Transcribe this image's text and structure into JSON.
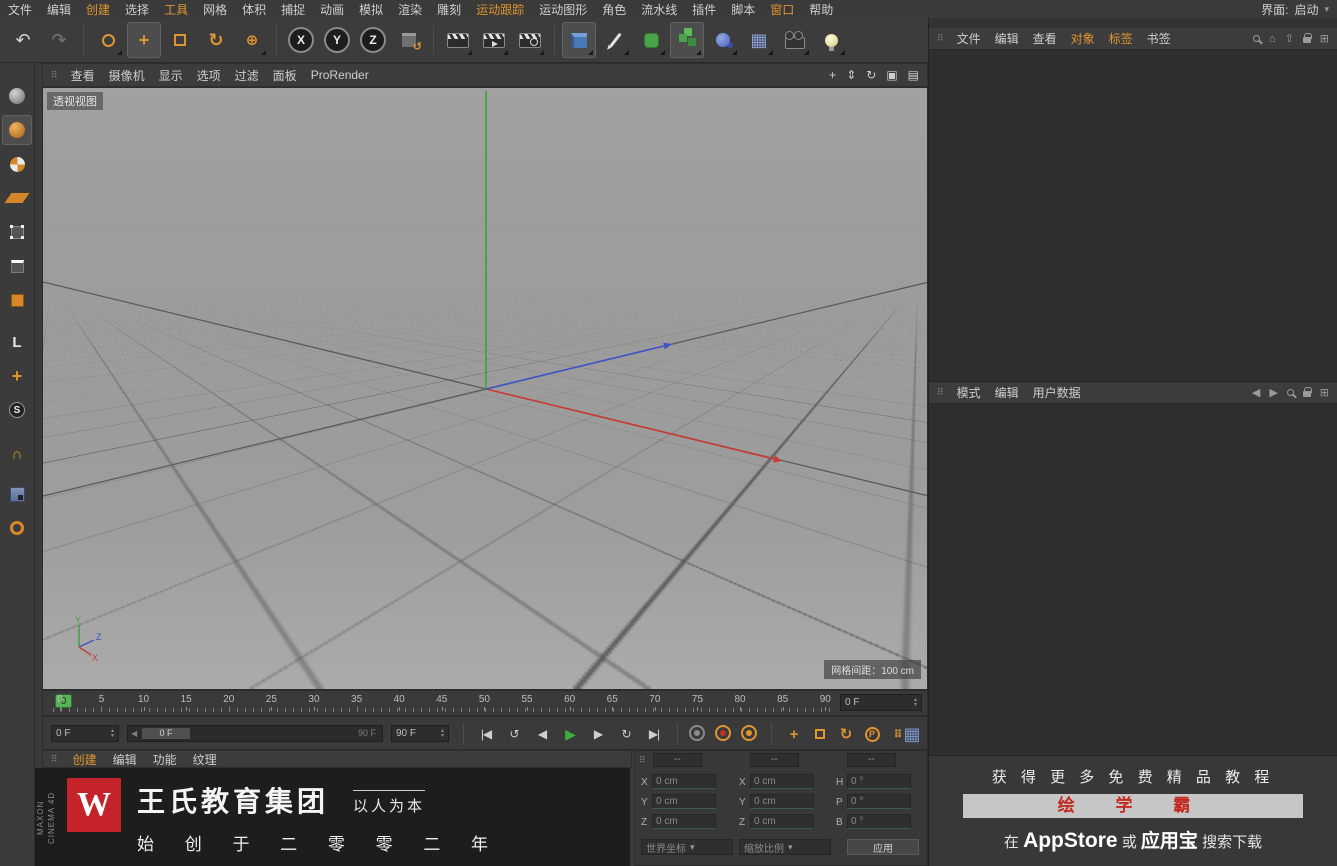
{
  "colors": {
    "accent": "#e0952f",
    "play_green": "#3fae3f",
    "banner_red": "#c4232a",
    "axis_red": "#cc3a33",
    "axis_green": "#3aa33a",
    "axis_blue": "#4053c8",
    "viewport_gray": "#9d9d9d"
  },
  "menubar": {
    "items": [
      {
        "label": "文件",
        "hl": false
      },
      {
        "label": "编辑",
        "hl": false
      },
      {
        "label": "创建",
        "hl": true
      },
      {
        "label": "选择",
        "hl": false
      },
      {
        "label": "工具",
        "hl": true
      },
      {
        "label": "网格",
        "hl": false
      },
      {
        "label": "体积",
        "hl": false
      },
      {
        "label": "捕捉",
        "hl": false
      },
      {
        "label": "动画",
        "hl": false
      },
      {
        "label": "模拟",
        "hl": false
      },
      {
        "label": "渲染",
        "hl": false
      },
      {
        "label": "雕刻",
        "hl": false
      },
      {
        "label": "运动跟踪",
        "hl": true
      },
      {
        "label": "运动图形",
        "hl": false
      },
      {
        "label": "角色",
        "hl": false
      },
      {
        "label": "流水线",
        "hl": false
      },
      {
        "label": "插件",
        "hl": false
      },
      {
        "label": "脚本",
        "hl": false
      },
      {
        "label": "窗口",
        "hl": true
      },
      {
        "label": "帮助",
        "hl": false
      }
    ],
    "interface_label": "界面:",
    "interface_value": "启动"
  },
  "icons": {
    "handle": "⠿",
    "undo": "↶",
    "redo": "↷",
    "move_cross": "+",
    "rotate_circ": "↻",
    "plus_circle": "⊕",
    "coord_arrow": "↺",
    "axis_x": "X",
    "axis_y": "Y",
    "axis_z": "Z",
    "axis_l": "L",
    "snap_s": "S",
    "magnet": "∩",
    "pan": "+",
    "zoom": "⇕",
    "orbit": "↻",
    "maximize": "▣",
    "panel_menu": "▤",
    "home": "⌂",
    "up": "⇧",
    "grid_plus": "⊞",
    "field_grid": "▦",
    "goto_start": "|◀",
    "prev_key": "↺",
    "prev_frame": "◀",
    "play": "▶",
    "next_frame": "▶",
    "next_key": "↻",
    "goto_end": "▶|",
    "caret_down": "▾",
    "spin_up": "▴",
    "spin_down": "▾",
    "dots": "⠿",
    "p_letter": "P",
    "arrow_left": "◀",
    "arrow_right": "▶"
  },
  "left_toolbar": {
    "icon_names": [
      "make-editable",
      "model-mode",
      "texture-mode",
      "workplane-mode",
      "points-mode",
      "edges-mode",
      "polygons-mode",
      "axis-modification",
      "enable-axis",
      "snap-settings",
      "snap-magnet",
      "workplane-lock",
      "ring-tool"
    ]
  },
  "viewport": {
    "menu": [
      "查看",
      "摄像机",
      "显示",
      "选项",
      "过滤",
      "面板",
      "ProRender"
    ],
    "view_label": "透视视图",
    "grid_spacing": "网格间距：100 cm",
    "axis_x": "X",
    "axis_y": "Y",
    "axis_z": "Z"
  },
  "timeline": {
    "ticks": [
      "0",
      "5",
      "10",
      "15",
      "20",
      "25",
      "30",
      "35",
      "40",
      "45",
      "50",
      "55",
      "60",
      "65",
      "70",
      "75",
      "80",
      "85",
      "90"
    ],
    "marker": "0",
    "frame_field": "0 F"
  },
  "transport": {
    "current": "0 F",
    "range_start": "0 F",
    "range_end": "90 F",
    "end_field": "90 F"
  },
  "materials": {
    "tabs": [
      {
        "label": "创建",
        "hl": true
      },
      {
        "label": "编辑",
        "hl": false
      },
      {
        "label": "功能",
        "hl": false
      },
      {
        "label": "纹理",
        "hl": false
      }
    ]
  },
  "banner": {
    "logo_letter": "W",
    "title": "王氏教育集团",
    "tagline": "以人为本",
    "line2": "始 创 于 二 零 零 二 年",
    "side_text_top": "MAXON",
    "side_text_bottom": "CINEMA 4D"
  },
  "coords": {
    "headers": [
      "--",
      "--",
      "--"
    ],
    "rows": [
      {
        "c1_label": "X",
        "c1_value": "0 cm",
        "c2_label": "X",
        "c2_value": "0 cm",
        "c3_label": "H",
        "c3_value": "0 °"
      },
      {
        "c1_label": "Y",
        "c1_value": "0 cm",
        "c2_label": "Y",
        "c2_value": "0 cm",
        "c3_label": "P",
        "c3_value": "0 °"
      },
      {
        "c1_label": "Z",
        "c1_value": "0 cm",
        "c2_label": "Z",
        "c2_value": "0 cm",
        "c3_label": "B",
        "c3_value": "0 °"
      }
    ],
    "dropdown_left": "世界坐标",
    "dropdown_right": "缩放比例",
    "apply_button": "应用"
  },
  "object_manager": {
    "tabs": [
      {
        "label": "文件",
        "hl": false
      },
      {
        "label": "编辑",
        "hl": false
      },
      {
        "label": "查看",
        "hl": false
      },
      {
        "label": "对象",
        "hl": true
      },
      {
        "label": "标签",
        "hl": true
      },
      {
        "label": "书签",
        "hl": false
      }
    ]
  },
  "attribute_manager": {
    "tabs": [
      {
        "label": "模式",
        "hl": false
      },
      {
        "label": "编辑",
        "hl": false
      },
      {
        "label": "用户数据",
        "hl": false
      }
    ]
  },
  "ad": {
    "line1": "获 得 更 多 免 费 精 品 教 程",
    "badge": "绘 学 霸",
    "line3_pre": "在",
    "line3_store": "AppStore",
    "line3_mid": "或",
    "line3_app": "应用宝",
    "line3_suf": "搜索下载"
  }
}
